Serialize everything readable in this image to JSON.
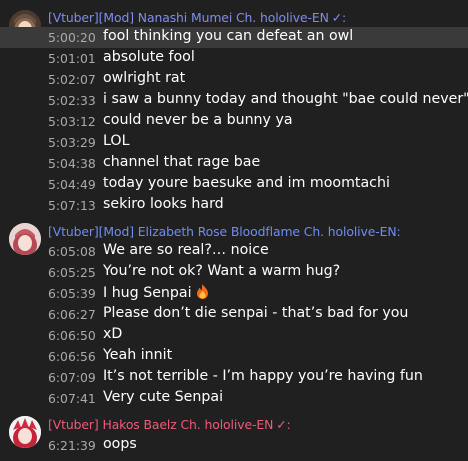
{
  "groups": [
    {
      "author": "[Vtuber][Mod] Nanashi Mumei Ch. hololive-EN",
      "verified": "✓:",
      "color": "#7f8df0",
      "messages": [
        {
          "time": "5:00:20",
          "text": "fool thinking you can defeat an owl",
          "highlight": true
        },
        {
          "time": "5:01:01",
          "text": "absolute fool"
        },
        {
          "time": "5:02:07",
          "text": "owlright rat"
        },
        {
          "time": "5:02:33",
          "text": "i saw a bunny today and thought \"bae could never\""
        },
        {
          "time": "5:03:12",
          "text": "could never be a bunny ya"
        },
        {
          "time": "5:03:29",
          "text": "LOL"
        },
        {
          "time": "5:04:38",
          "text": "channel that rage bae"
        },
        {
          "time": "5:04:49",
          "text": "today youre baesuke and im moomtachi"
        },
        {
          "time": "5:07:13",
          "text": "sekiro looks hard"
        }
      ]
    },
    {
      "author": "[Vtuber][Mod] Elizabeth Rose Bloodflame Ch. hololive-EN:",
      "verified": "",
      "color": "#6f8df4",
      "messages": [
        {
          "time": "6:05:08",
          "text": "We are so real?… noice"
        },
        {
          "time": "6:05:25",
          "text": "You’re not ok? Want a warm hug?"
        },
        {
          "time": "6:05:39",
          "text": "I hug Senpai",
          "icon": "fire-emoji-icon"
        },
        {
          "time": "6:06:27",
          "text": "Please don’t die senpai - that’s bad for you"
        },
        {
          "time": "6:06:50",
          "text": "xD"
        },
        {
          "time": "6:06:56",
          "text": "Yeah innit"
        },
        {
          "time": "6:07:09",
          "text": "It’s not terrible - I’m happy you’re having fun"
        },
        {
          "time": "6:07:41",
          "text": "Very cute Senpai"
        }
      ]
    },
    {
      "author": "[Vtuber] Hakos Baelz Ch. hololive-EN",
      "verified": "✓:",
      "color": "#ef5a7a",
      "messages": [
        {
          "time": "6:21:39",
          "text": "oops"
        }
      ]
    }
  ]
}
